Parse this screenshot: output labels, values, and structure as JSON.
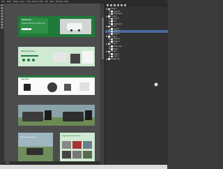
{
  "app": {
    "menu_items": [
      "File",
      "Edit",
      "Image",
      "Layer",
      "Type",
      "Select",
      "Filter",
      "3D",
      "View",
      "Window",
      "Help"
    ],
    "zoom": "25%"
  },
  "canvas": {
    "banner1": {
      "headline": "WINDBOUND",
      "subline": "RELIABLE SECURITY FOR EVERY RIDE",
      "cta": "SHOP NOW"
    },
    "banner2": {
      "headline": "WINDBOUND RACK"
    },
    "banner3": {
      "headline": "FEATURES"
    },
    "banner5": {
      "headline": "Built to Go Anywhere"
    },
    "banner6": {
      "headline": "Engineered for Adventure"
    }
  },
  "layers_panel": {
    "layers": [
      "Group 1",
      "Layer 12",
      "Rectangle 3",
      "Group 2",
      "Layer 8",
      "Text",
      "Rectangle 1",
      "Group 3",
      "Layer 5",
      "Layer 4",
      "Layer 3",
      "Group 4",
      "Shape 2",
      "Shape 1",
      "Group 5",
      "Photo copy",
      "Photo",
      "Group 6",
      "Layer 2",
      "Layer 1",
      "Background"
    ],
    "selected_index": 9
  },
  "colors": {
    "accent": "#1f7a3a",
    "accent_light": "#cfe9d3",
    "ui_dark": "#323232"
  }
}
